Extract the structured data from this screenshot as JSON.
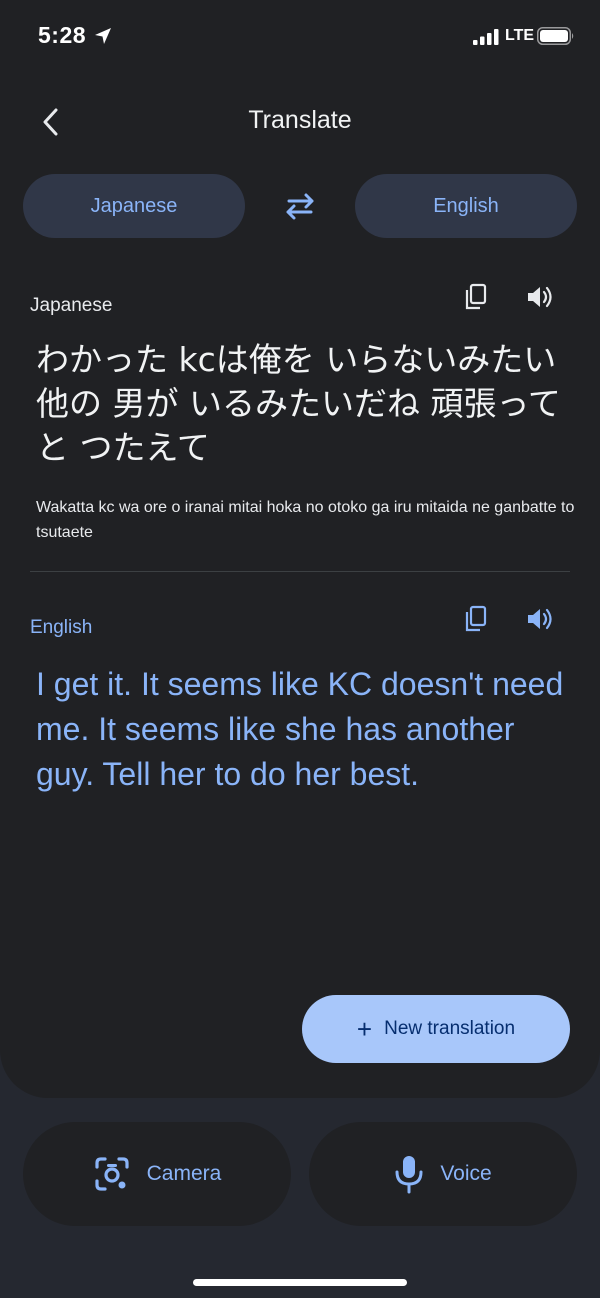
{
  "status_bar": {
    "time": "5:28",
    "network": "LTE"
  },
  "header": {
    "title": "Translate",
    "back_icon": "chevron-left-icon"
  },
  "languages": {
    "source": "Japanese",
    "target": "English",
    "swap_icon": "swap-arrows-icon"
  },
  "source_panel": {
    "label": "Japanese",
    "text": "わかった kcは俺を いらないみたい 他の 男が いるみたいだね 頑張ってと つたえて",
    "transliteration": "Wakatta kc wa ore o iranai mitai hoka no otoko ga iru mitaida ne ganbatte to tsutaete",
    "copy_icon": "copy-icon",
    "speaker_icon": "speaker-icon"
  },
  "target_panel": {
    "label": "English",
    "text": "I get it. It seems like KC doesn't need me. It seems like she has another guy. Tell her to do her best.",
    "copy_icon": "copy-icon",
    "speaker_icon": "speaker-icon"
  },
  "actions": {
    "new_translation_label": "New translation",
    "camera_label": "Camera",
    "voice_label": "Voice"
  },
  "colors": {
    "background": "#202124",
    "accent": "#8ab4f8",
    "pill": "#303748",
    "primary_button": "#a8c7fa"
  }
}
